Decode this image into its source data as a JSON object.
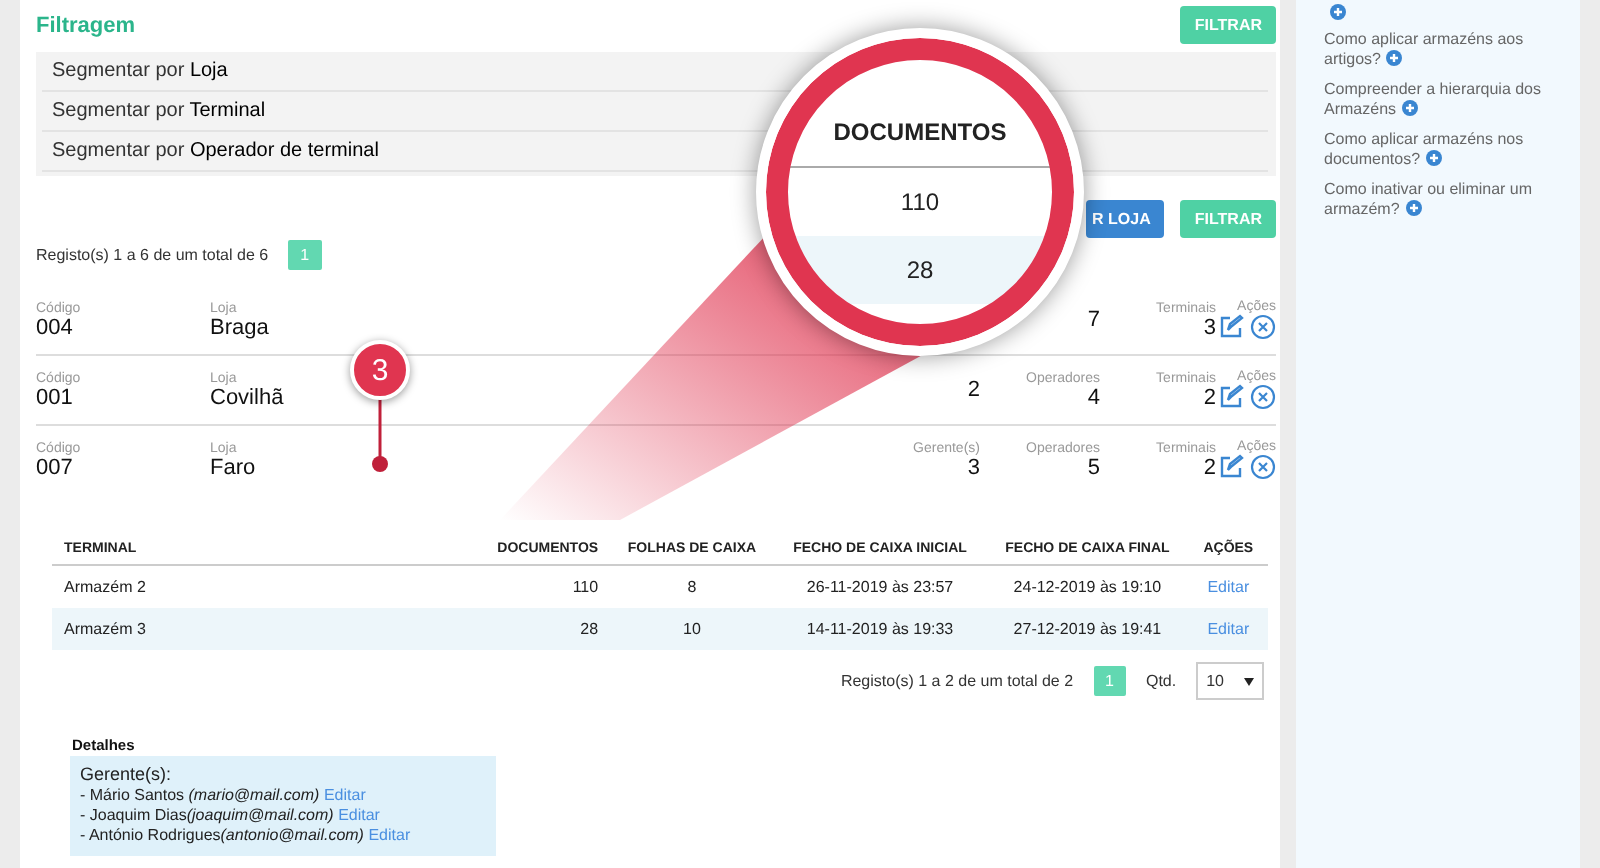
{
  "filter": {
    "title": "Filtragem",
    "button": "FILTRAR",
    "segments": [
      "Segmentar por **Loja**",
      "Segmentar por **Terminal**",
      "Segmentar por **Operador de terminal**"
    ]
  },
  "actions": [
    {
      "label": "R LOJA",
      "kind": "primary"
    },
    {
      "label": "FILTRAR",
      "kind": "success"
    }
  ],
  "stores": {
    "summary": "Registo(s) 1 a 6 de um total de 6",
    "pages": [
      {
        "label": "1",
        "selected": true
      }
    ],
    "rows": [
      {
        "code_label": "Código",
        "code": "004",
        "store_label": "Loja",
        "store": "Braga",
        "operators_value": "7",
        "terminals_label": "Terminais",
        "terminals": "3",
        "actions_label": "Ações"
      },
      {
        "code_label": "Código",
        "code": "001",
        "store_label": "Loja",
        "store": "Covilhã",
        "managers_value": "2",
        "operators_label": "Operadores",
        "operators_value": "4",
        "terminals_label": "Terminais",
        "terminals": "2",
        "actions_label": "Ações"
      },
      {
        "code_label": "Código",
        "code": "007",
        "store_label": "Loja",
        "store": "Faro",
        "managers_label": "Gerente(s)",
        "managers_value": "3",
        "operators_label": "Operadores",
        "operators_value": "5",
        "terminals_label": "Terminais",
        "terminals": "2",
        "actions_label": "Ações"
      }
    ]
  },
  "terminals": {
    "columns": [
      "TERMINAL",
      "DOCUMENTOS",
      "FOLHAS DE CAIXA",
      "FECHO DE CAIXA INICIAL",
      "FECHO DE CAIXA FINAL",
      "AÇÕES"
    ],
    "rows": [
      {
        "terminal": "Armazém 2",
        "documents": "110",
        "sheets": "8",
        "open": "26-11-2019 às 23:57",
        "close": "24-12-2019 às 19:10",
        "action": "Editar"
      },
      {
        "terminal": "Armazém 3",
        "documents": "28",
        "sheets": "10",
        "open": "14-11-2019 às 19:33",
        "close": "27-12-2019 às 19:41",
        "action": "Editar"
      }
    ],
    "summary": "Registo(s) 1 a 2 de um total de 2",
    "pages": [
      {
        "label": "1",
        "selected": true
      }
    ],
    "qty_label": "Qtd.",
    "qty_value": "10"
  },
  "details": {
    "title": "Detalhes",
    "heading": "Gerente(s):",
    "people": [
      {
        "name": "- Mário Santos ",
        "email": "(mario@mail.com)",
        "link": "Editar"
      },
      {
        "name": "- Joaquim Dias",
        "email": "(joaquim@mail.com)",
        "link": "Editar"
      },
      {
        "name": "- António Rodrigues",
        "email": "(antonio@mail.com)",
        "link": "Editar"
      }
    ]
  },
  "sidebar": {
    "items": [
      "Como aplicar armazéns aos artigos?",
      "Compreender a hierarquia dos Armazéns",
      "Como aplicar armazéns nos documentos?",
      "Como inativar ou eliminar um armazém?"
    ]
  },
  "magnifier": {
    "header": "DOCUMENTOS",
    "values": [
      "110",
      "28"
    ]
  },
  "callout": {
    "number": "3"
  }
}
